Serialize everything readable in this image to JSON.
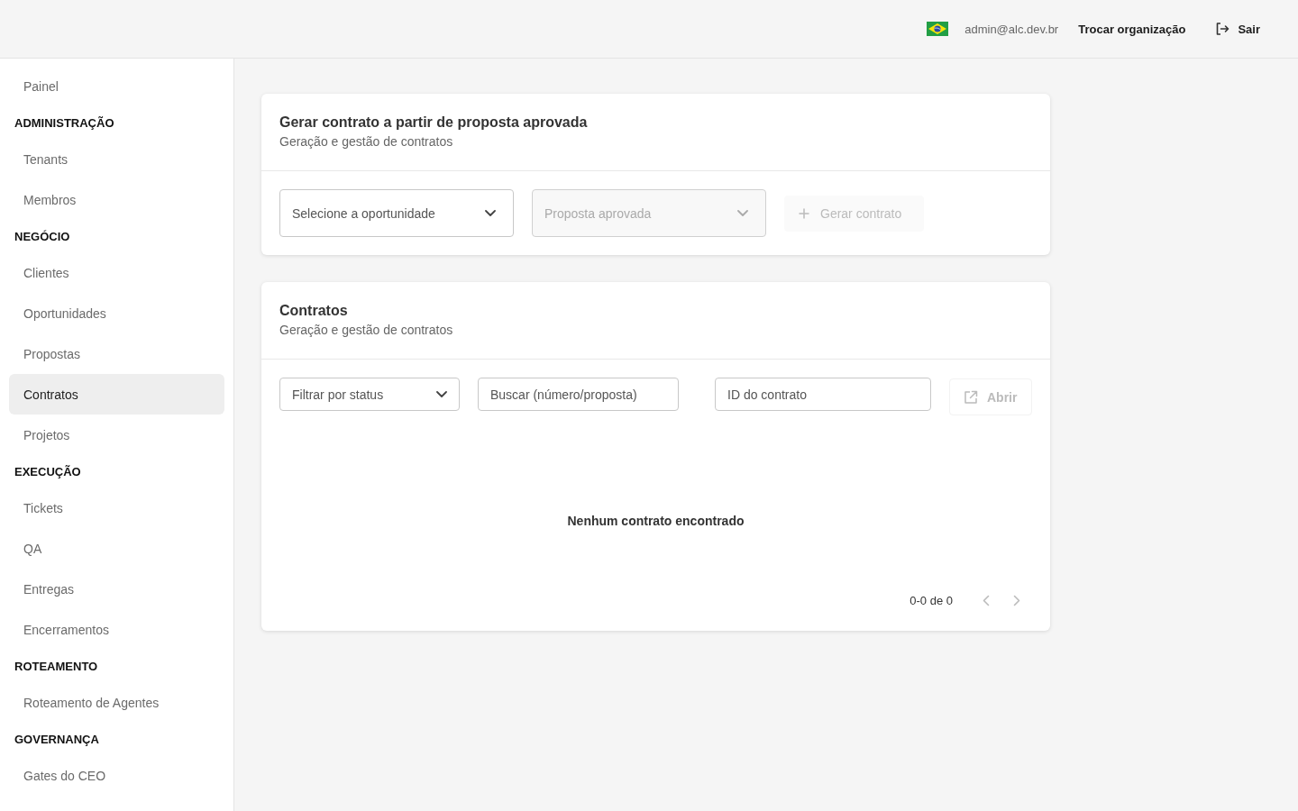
{
  "topbar": {
    "email": "admin@alc.dev.br",
    "switch_org": "Trocar organização",
    "logout": "Sair"
  },
  "sidebar": {
    "sections": [
      {
        "items": [
          {
            "label": "Painel",
            "selected": false
          }
        ]
      },
      {
        "heading": "ADMINISTRAÇÃO",
        "items": [
          {
            "label": "Tenants",
            "selected": false
          },
          {
            "label": "Membros",
            "selected": false
          }
        ]
      },
      {
        "heading": "NEGÓCIO",
        "items": [
          {
            "label": "Clientes",
            "selected": false
          },
          {
            "label": "Oportunidades",
            "selected": false
          },
          {
            "label": "Propostas",
            "selected": false
          },
          {
            "label": "Contratos",
            "selected": true
          },
          {
            "label": "Projetos",
            "selected": false
          }
        ]
      },
      {
        "heading": "EXECUÇÃO",
        "items": [
          {
            "label": "Tickets",
            "selected": false
          },
          {
            "label": "QA",
            "selected": false
          },
          {
            "label": "Entregas",
            "selected": false
          },
          {
            "label": "Encerramentos",
            "selected": false
          }
        ]
      },
      {
        "heading": "ROTEAMENTO",
        "items": [
          {
            "label": "Roteamento de Agentes",
            "selected": false
          }
        ]
      },
      {
        "heading": "GOVERNANÇA",
        "items": [
          {
            "label": "Gates do CEO",
            "selected": false
          }
        ]
      }
    ]
  },
  "generate_card": {
    "title": "Gerar contrato a partir de proposta aprovada",
    "subtitle": "Geração e gestão de contratos",
    "opportunity_select": {
      "placeholder": "Selecione a oportunidade",
      "disabled": false
    },
    "proposal_select": {
      "placeholder": "Proposta aprovada",
      "disabled": true
    },
    "generate_button": {
      "label": "Gerar contrato",
      "disabled": true
    }
  },
  "contracts_card": {
    "title": "Contratos",
    "subtitle": "Geração e gestão de contratos",
    "status_filter": {
      "placeholder": "Filtrar por status"
    },
    "search": {
      "placeholder": "Buscar (número/proposta)"
    },
    "contract_id": {
      "placeholder": "ID do contrato"
    },
    "open_button": {
      "label": "Abrir",
      "disabled": true
    },
    "empty_message": "Nenhum contrato encontrado",
    "pagination": {
      "range": "0-0 de 0",
      "prev_disabled": true,
      "next_disabled": true
    }
  }
}
